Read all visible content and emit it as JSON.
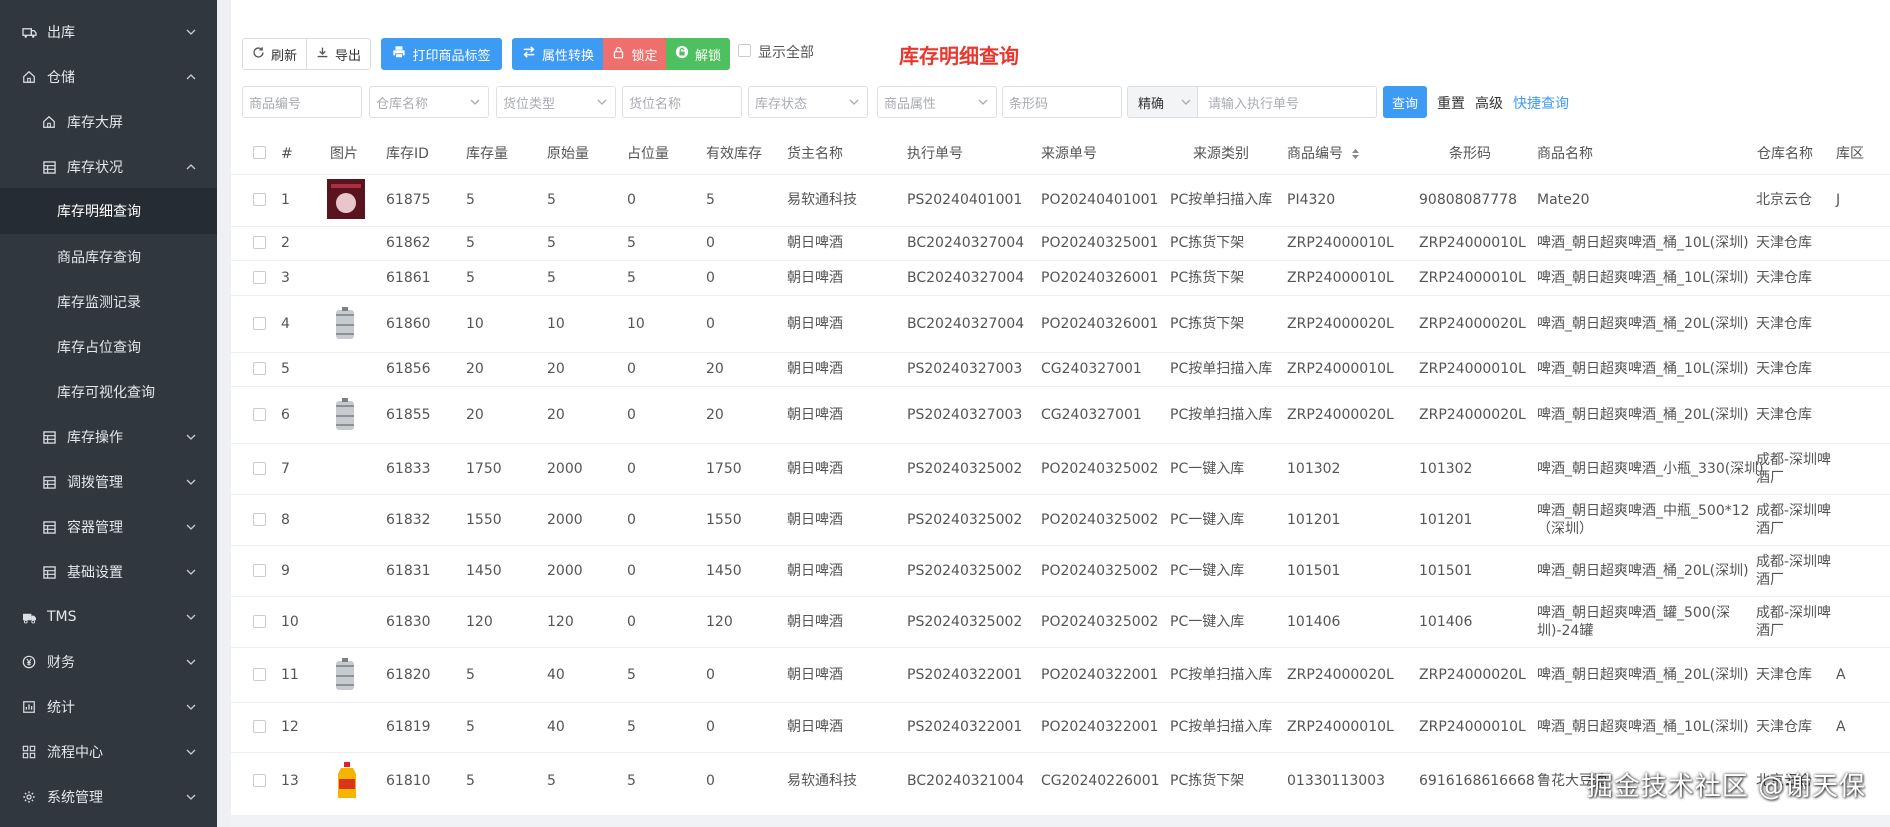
{
  "sidebar": {
    "items": [
      {
        "label": "出库",
        "icon": "truck-out-icon",
        "level": 1,
        "expanded": false
      },
      {
        "label": "仓储",
        "icon": "home-icon",
        "level": 1,
        "expanded": true
      },
      {
        "label": "库存大屏",
        "icon": "home-icon",
        "level": 2
      },
      {
        "label": "库存状况",
        "icon": "grid-icon",
        "level": 2,
        "expanded": true
      },
      {
        "label": "库存明细查询",
        "level": 3,
        "active": true
      },
      {
        "label": "商品库存查询",
        "level": 3
      },
      {
        "label": "库存监测记录",
        "level": 3
      },
      {
        "label": "库存占位查询",
        "level": 3
      },
      {
        "label": "库存可视化查询",
        "level": 3
      },
      {
        "label": "库存操作",
        "icon": "grid-icon",
        "level": 2,
        "expanded": false
      },
      {
        "label": "调拨管理",
        "icon": "grid-icon",
        "level": 2,
        "expanded": false
      },
      {
        "label": "容器管理",
        "icon": "grid-icon",
        "level": 2,
        "expanded": false
      },
      {
        "label": "基础设置",
        "icon": "grid-icon",
        "level": 2,
        "expanded": false
      },
      {
        "label": "TMS",
        "icon": "truck-icon",
        "level": 1,
        "expanded": false
      },
      {
        "label": "财务",
        "icon": "yen-icon",
        "level": 1,
        "expanded": false
      },
      {
        "label": "统计",
        "icon": "stats-icon",
        "level": 1,
        "expanded": false
      },
      {
        "label": "流程中心",
        "icon": "flow-icon",
        "level": 1,
        "expanded": false
      },
      {
        "label": "系统管理",
        "icon": "gear-icon",
        "level": 1,
        "expanded": false
      }
    ]
  },
  "toolbar": {
    "refresh": "刷新",
    "export": "导出",
    "print_label": "打印商品标签",
    "attr_convert": "属性转换",
    "lock": "锁定",
    "unlock": "解锁",
    "show_all": "显示全部"
  },
  "page_title": "库存明细查询",
  "filters": {
    "product_code": "商品编号",
    "warehouse_name": "仓库名称",
    "location_type": "货位类型",
    "location_name": "货位名称",
    "stock_status": "库存状态",
    "product_attr": "商品属性",
    "barcode": "条形码",
    "match_mode": "精确",
    "exec_no_placeholder": "请输入执行单号",
    "query": "查询",
    "reset": "重置",
    "advanced": "高级",
    "quick_query": "快捷查询"
  },
  "table": {
    "headers": [
      "#",
      "图片",
      "库存ID",
      "库存量",
      "原始量",
      "占位量",
      "有效库存",
      "货主名称",
      "执行单号",
      "来源单号",
      "来源类别",
      "商品编号",
      "条形码",
      "商品名称",
      "仓库名称",
      "库区"
    ],
    "rows": [
      {
        "no": "1",
        "img": "photo",
        "id": "61875",
        "qty": "5",
        "orig": "5",
        "occ": "0",
        "eff": "5",
        "owner": "易软通科技",
        "exec": "PS20240401001",
        "src": "PO20240401001",
        "src_type": "PC按单扫描入库",
        "code": "PI4320",
        "barcode": "90808087778",
        "name": "Mate20",
        "wh": "北京云仓",
        "zone": "J"
      },
      {
        "no": "2",
        "img": "",
        "id": "61862",
        "qty": "5",
        "orig": "5",
        "occ": "5",
        "eff": "0",
        "owner": "朝日啤酒",
        "exec": "BC20240327004",
        "src": "PO20240325001",
        "src_type": "PC拣货下架",
        "code": "ZRP24000010L",
        "barcode": "ZRP24000010L",
        "name": "啤酒_朝日超爽啤酒_桶_10L(深圳)",
        "wh": "天津仓库",
        "zone": ""
      },
      {
        "no": "3",
        "img": "",
        "id": "61861",
        "qty": "5",
        "orig": "5",
        "occ": "5",
        "eff": "0",
        "owner": "朝日啤酒",
        "exec": "BC20240327004",
        "src": "PO20240326001",
        "src_type": "PC拣货下架",
        "code": "ZRP24000010L",
        "barcode": "ZRP24000010L",
        "name": "啤酒_朝日超爽啤酒_桶_10L(深圳)",
        "wh": "天津仓库",
        "zone": ""
      },
      {
        "no": "4",
        "img": "keg",
        "id": "61860",
        "qty": "10",
        "orig": "10",
        "occ": "10",
        "eff": "0",
        "owner": "朝日啤酒",
        "exec": "BC20240327004",
        "src": "PO20240326001",
        "src_type": "PC拣货下架",
        "code": "ZRP24000020L",
        "barcode": "ZRP24000020L",
        "name": "啤酒_朝日超爽啤酒_桶_20L(深圳)",
        "wh": "天津仓库",
        "zone": ""
      },
      {
        "no": "5",
        "img": "",
        "id": "61856",
        "qty": "20",
        "orig": "20",
        "occ": "0",
        "eff": "20",
        "owner": "朝日啤酒",
        "exec": "PS20240327003",
        "src": "CG240327001",
        "src_type": "PC按单扫描入库",
        "code": "ZRP24000010L",
        "barcode": "ZRP24000010L",
        "name": "啤酒_朝日超爽啤酒_桶_10L(深圳)",
        "wh": "天津仓库",
        "zone": ""
      },
      {
        "no": "6",
        "img": "keg",
        "id": "61855",
        "qty": "20",
        "orig": "20",
        "occ": "0",
        "eff": "20",
        "owner": "朝日啤酒",
        "exec": "PS20240327003",
        "src": "CG240327001",
        "src_type": "PC按单扫描入库",
        "code": "ZRP24000020L",
        "barcode": "ZRP24000020L",
        "name": "啤酒_朝日超爽啤酒_桶_20L(深圳)",
        "wh": "天津仓库",
        "zone": ""
      },
      {
        "no": "7",
        "img": "",
        "id": "61833",
        "qty": "1750",
        "orig": "2000",
        "occ": "0",
        "eff": "1750",
        "owner": "朝日啤酒",
        "exec": "PS20240325002",
        "src": "PO20240325002",
        "src_type": "PC一键入库",
        "code": "101302",
        "barcode": "101302",
        "name": "啤酒_朝日超爽啤酒_小瓶_330(深圳)",
        "wh": "成都-深圳啤酒厂",
        "zone": ""
      },
      {
        "no": "8",
        "img": "",
        "id": "61832",
        "qty": "1550",
        "orig": "2000",
        "occ": "0",
        "eff": "1550",
        "owner": "朝日啤酒",
        "exec": "PS20240325002",
        "src": "PO20240325002",
        "src_type": "PC一键入库",
        "code": "101201",
        "barcode": "101201",
        "name": "啤酒_朝日超爽啤酒_中瓶_500*12（深圳）",
        "wh": "成都-深圳啤酒厂",
        "zone": ""
      },
      {
        "no": "9",
        "img": "",
        "id": "61831",
        "qty": "1450",
        "orig": "2000",
        "occ": "0",
        "eff": "1450",
        "owner": "朝日啤酒",
        "exec": "PS20240325002",
        "src": "PO20240325002",
        "src_type": "PC一键入库",
        "code": "101501",
        "barcode": "101501",
        "name": "啤酒_朝日超爽啤酒_桶_20L(深圳)",
        "wh": "成都-深圳啤酒厂",
        "zone": ""
      },
      {
        "no": "10",
        "img": "",
        "id": "61830",
        "qty": "120",
        "orig": "120",
        "occ": "0",
        "eff": "120",
        "owner": "朝日啤酒",
        "exec": "PS20240325002",
        "src": "PO20240325002",
        "src_type": "PC一键入库",
        "code": "101406",
        "barcode": "101406",
        "name": "啤酒_朝日超爽啤酒_罐_500(深圳)-24罐",
        "wh": "成都-深圳啤酒厂",
        "zone": ""
      },
      {
        "no": "11",
        "img": "keg",
        "id": "61820",
        "qty": "5",
        "orig": "40",
        "occ": "5",
        "eff": "0",
        "owner": "朝日啤酒",
        "exec": "PS20240322001",
        "src": "PO20240322001",
        "src_type": "PC按单扫描入库",
        "code": "ZRP24000020L",
        "barcode": "ZRP24000020L",
        "name": "啤酒_朝日超爽啤酒_桶_20L(深圳)",
        "wh": "天津仓库",
        "zone": "A"
      },
      {
        "no": "12",
        "img": "",
        "id": "61819",
        "qty": "5",
        "orig": "40",
        "occ": "5",
        "eff": "0",
        "owner": "朝日啤酒",
        "exec": "PS20240322001",
        "src": "PO20240322001",
        "src_type": "PC按单扫描入库",
        "code": "ZRP24000010L",
        "barcode": "ZRP24000010L",
        "name": "啤酒_朝日超爽啤酒_桶_10L(深圳)",
        "wh": "天津仓库",
        "zone": "A"
      },
      {
        "no": "13",
        "img": "oil",
        "id": "61810",
        "qty": "5",
        "orig": "5",
        "occ": "5",
        "eff": "0",
        "owner": "易软通科技",
        "exec": "BC20240321004",
        "src": "CG20240226001",
        "src_type": "PC拣货下架",
        "code": "01330113003",
        "barcode": "6916168616668",
        "name": "鲁花大豆油",
        "wh": "北京云仓",
        "zone": ""
      }
    ]
  },
  "watermark": "掘金技术社区 @谢天保",
  "colors": {
    "sidebar": "#30373f",
    "accent_blue": "#3e9bf3",
    "red": "#ef6f6c",
    "green": "#4fc05f",
    "title_red": "#e8372f"
  }
}
